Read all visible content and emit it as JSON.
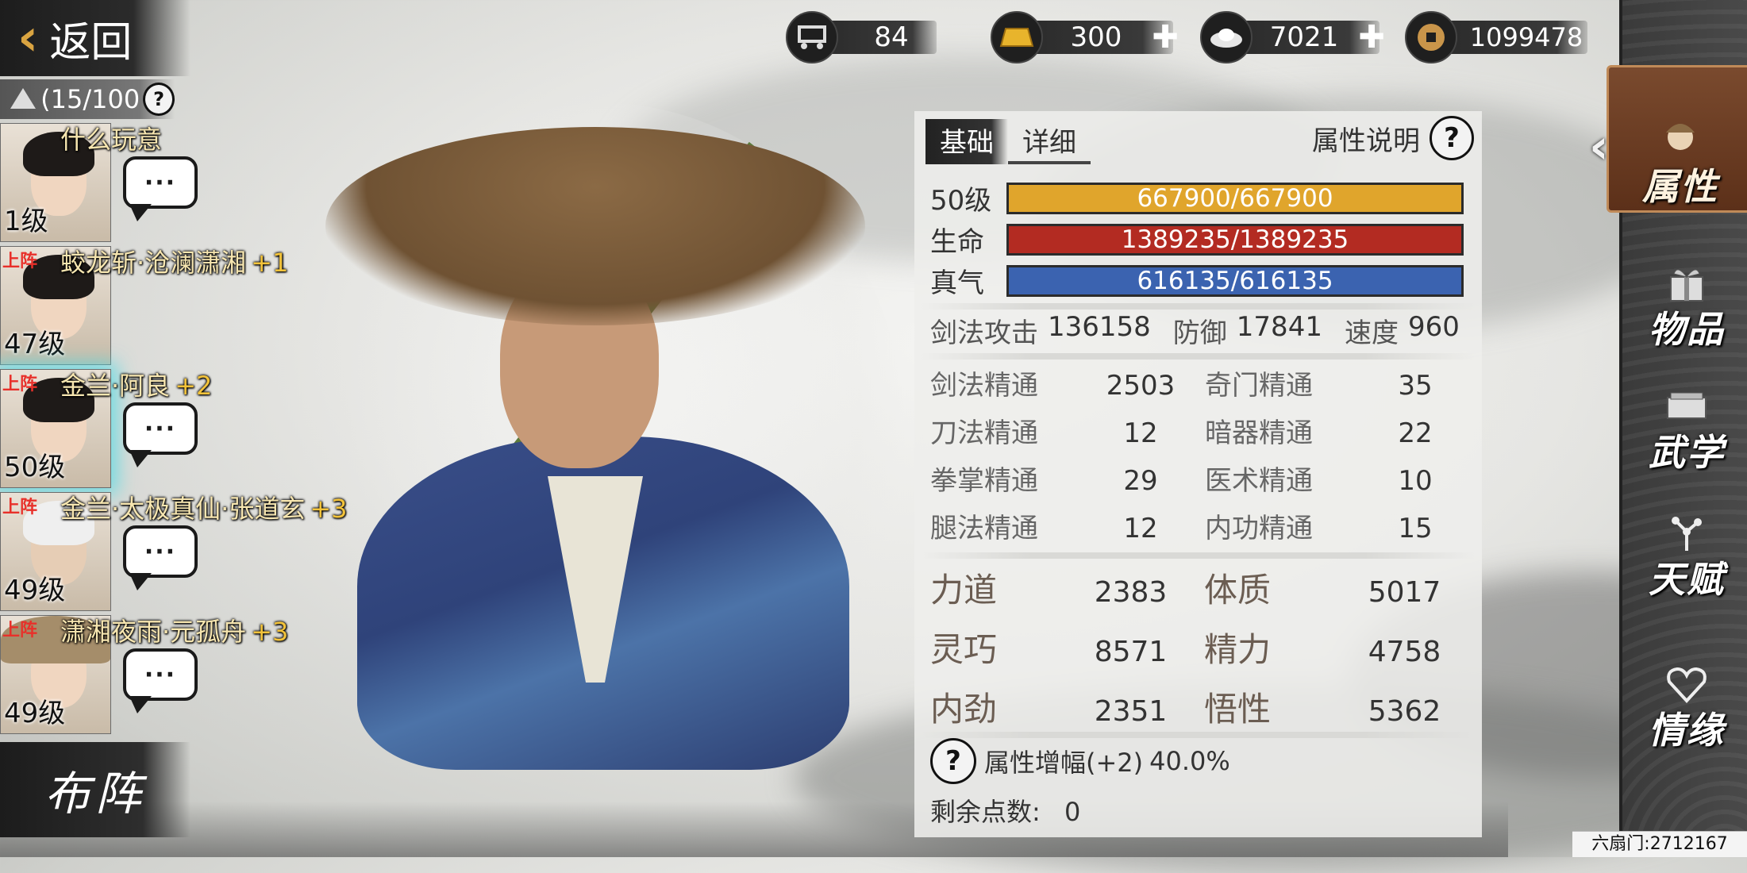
{
  "back": {
    "label": "返回"
  },
  "currencies": [
    {
      "icon": "cart-icon",
      "value": "84",
      "has_plus": false
    },
    {
      "icon": "gold-bar-icon",
      "value": "300",
      "has_plus": true
    },
    {
      "icon": "silver-ingot-icon",
      "value": "7021",
      "has_plus": true
    },
    {
      "icon": "copper-coin-icon",
      "value": "1099478",
      "has_plus": false
    }
  ],
  "roster": {
    "count": "(15/100",
    "members": [
      {
        "name": "什么玩意",
        "plus": "",
        "level": "1级",
        "on_field": "",
        "selected": false
      },
      {
        "name": "蛟龙斩·沧澜潇湘",
        "plus": "+1",
        "level": "47级",
        "on_field": "上阵",
        "selected": false
      },
      {
        "name": "金兰·阿良",
        "plus": "+2",
        "level": "50级",
        "on_field": "上阵",
        "selected": true
      },
      {
        "name": "金兰·太极真仙·张道玄",
        "plus": "+3",
        "level": "49级",
        "on_field": "上阵",
        "selected": false
      },
      {
        "name": "潇湘夜雨·元孤舟",
        "plus": "+3",
        "level": "49级",
        "on_field": "上阵",
        "selected": false
      }
    ],
    "bubble": "···",
    "formation_label": "布阵"
  },
  "panel": {
    "tab_basic": "基础",
    "tab_detail": "详细",
    "explain_label": "属性说明",
    "bars": {
      "level": {
        "label": "50级",
        "text": "667900/667900",
        "fraction": 1.0,
        "color": "#e0a52c"
      },
      "hp": {
        "label": "生命",
        "text": "1389235/1389235",
        "fraction": 1.0,
        "color": "#b32b22"
      },
      "qi": {
        "label": "真气",
        "text": "616135/616135",
        "fraction": 1.0,
        "color": "#3b63b0"
      }
    },
    "combat": [
      {
        "label": "剑法攻击",
        "value": "136158"
      },
      {
        "label": "防御",
        "value": "17841"
      },
      {
        "label": "速度",
        "value": "960"
      }
    ],
    "mastery": [
      {
        "label": "剑法精通",
        "value": "2503",
        "label2": "奇门精通",
        "value2": "35"
      },
      {
        "label": "刀法精通",
        "value": "12",
        "label2": "暗器精通",
        "value2": "22"
      },
      {
        "label": "拳掌精通",
        "value": "29",
        "label2": "医术精通",
        "value2": "10"
      },
      {
        "label": "腿法精通",
        "value": "12",
        "label2": "内功精通",
        "value2": "15"
      }
    ],
    "attributes": [
      {
        "label": "力道",
        "value": "2383",
        "label2": "体质",
        "value2": "5017"
      },
      {
        "label": "灵巧",
        "value": "8571",
        "label2": "精力",
        "value2": "4758"
      },
      {
        "label": "内劲",
        "value": "2351",
        "label2": "悟性",
        "value2": "5362"
      }
    ],
    "bonus_label": "属性增幅(+2)",
    "bonus_value": "40.0%",
    "remain_label": "剩余点数:",
    "remain_value": "0"
  },
  "nav": [
    {
      "label": "属性",
      "icon": "character-icon",
      "active": true
    },
    {
      "label": "物品",
      "icon": "gift-box-icon",
      "active": false
    },
    {
      "label": "武学",
      "icon": "scroll-book-icon",
      "active": false
    },
    {
      "label": "天赋",
      "icon": "talent-tree-icon",
      "active": false
    },
    {
      "label": "情缘",
      "icon": "heart-icon",
      "active": false
    }
  ],
  "footer": {
    "server_id": "六扇门:2712167"
  },
  "question_mark": "?"
}
